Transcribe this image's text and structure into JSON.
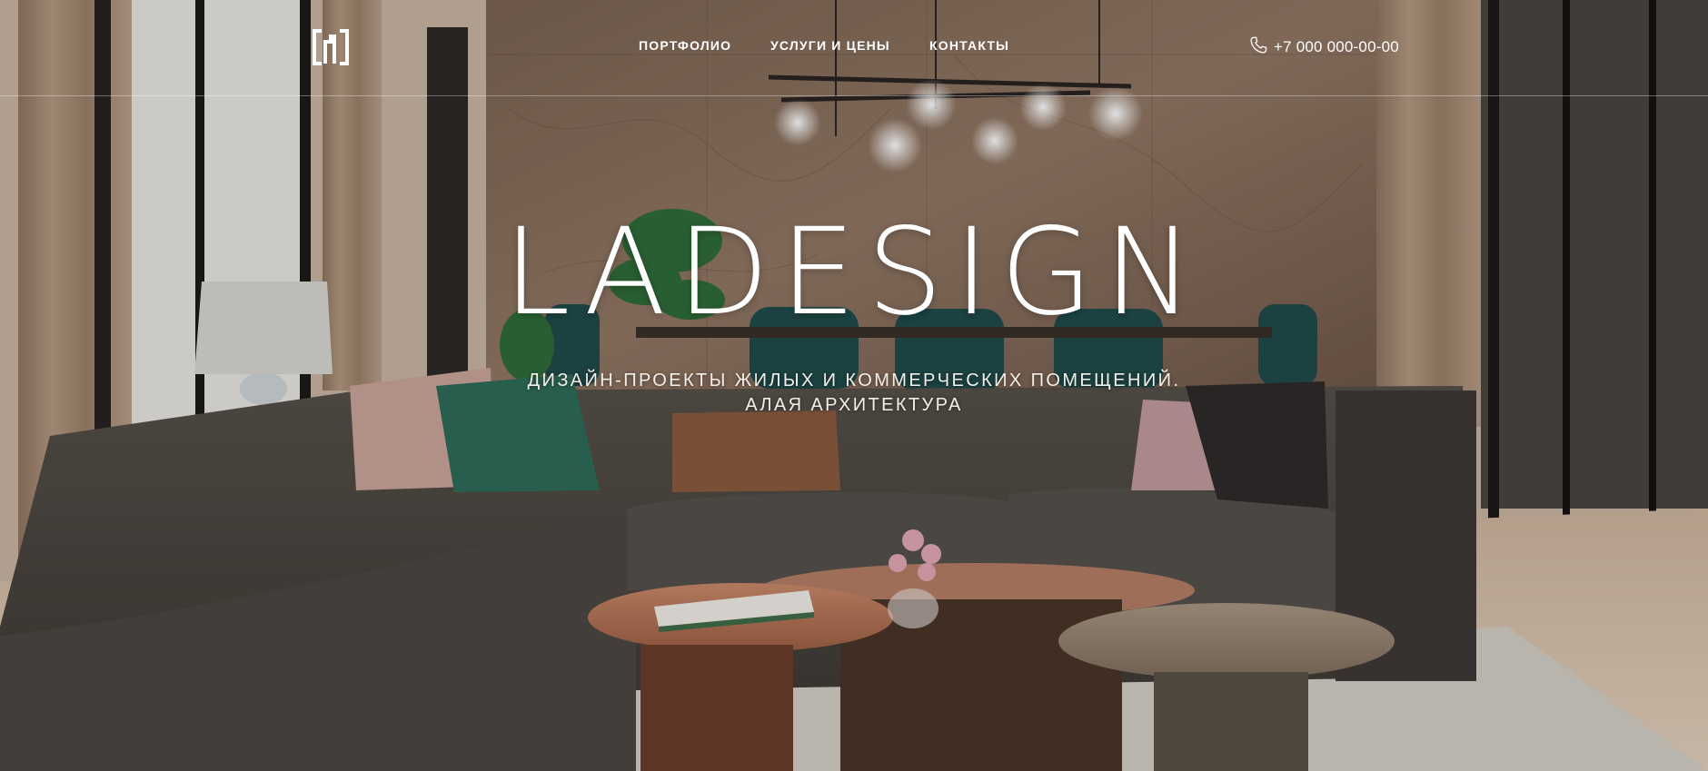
{
  "site": {
    "logo_icon": "bracket-logo-icon",
    "brand_color": "#ffffff"
  },
  "nav": {
    "items": [
      {
        "label": "ПОРТФОЛИО"
      },
      {
        "label": "УСЛУГИ И ЦЕНЫ"
      },
      {
        "label": "КОНТАКТЫ"
      }
    ]
  },
  "phone": {
    "icon": "phone-icon",
    "number": "+7 000 000-00-00"
  },
  "hero": {
    "title": "LADESIGN",
    "subtitle_line1": "ДИЗАЙН-ПРОЕКТЫ ЖИЛЫХ И КОММЕРЧЕСКИХ ПОМЕЩЕНИЙ.",
    "subtitle_line2": "АЛАЯ АРХИТЕКТУРА"
  },
  "background": {
    "scene": "living-room-interior-photo",
    "colors": {
      "marble_wall": "#8a7360",
      "sofa": "#4a4541",
      "floor": "#d8c3ae",
      "curtain": "#a88c74"
    }
  }
}
